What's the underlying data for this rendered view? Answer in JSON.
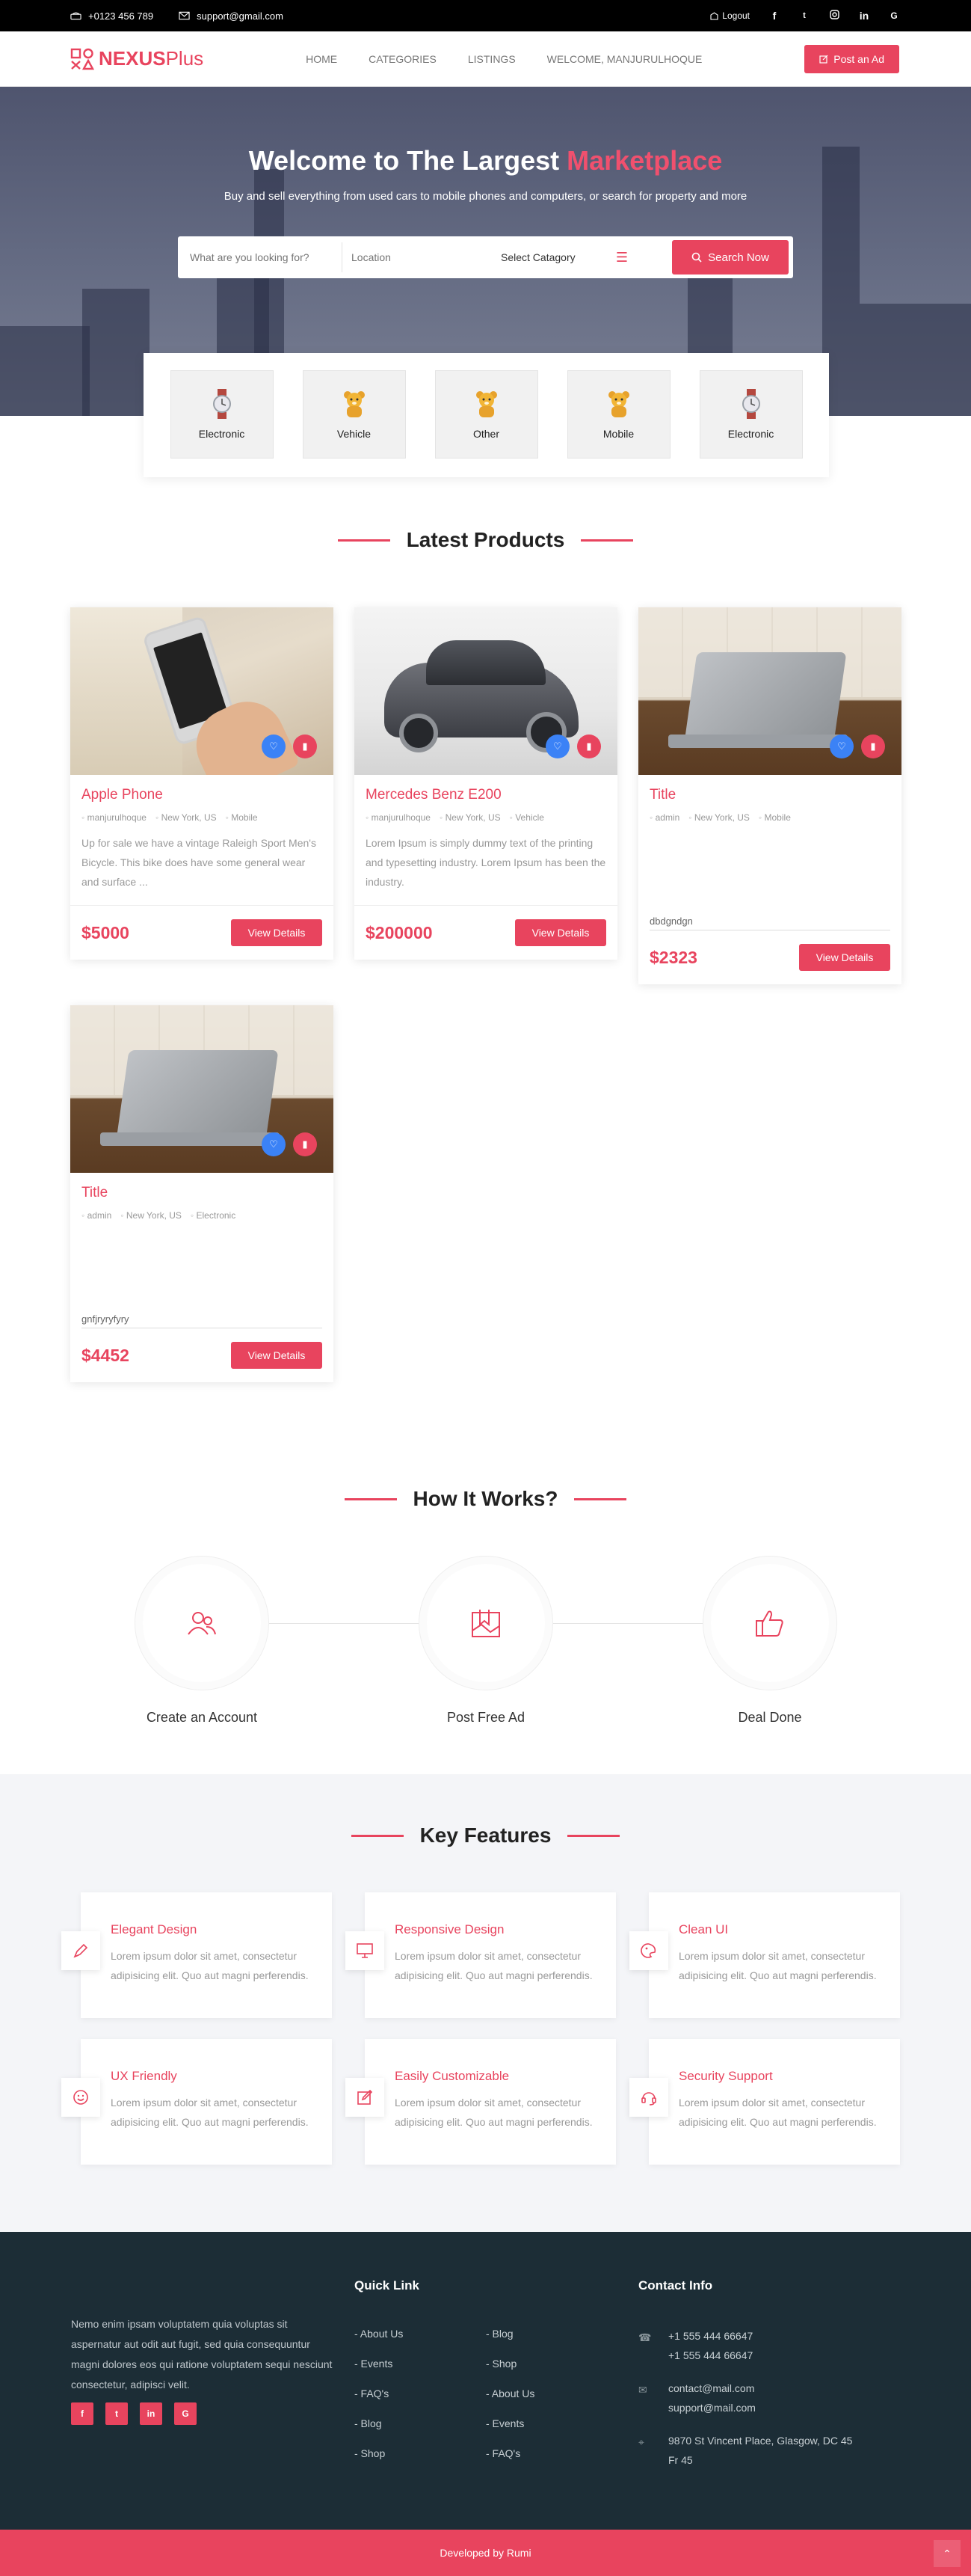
{
  "topbar": {
    "phone": "+0123 456 789",
    "email": "support@gmail.com",
    "logout": "Logout",
    "social": [
      "f",
      "t",
      "ig",
      "in",
      "G"
    ]
  },
  "nav": {
    "logo_main": "NEXUS",
    "logo_plus": "Plus",
    "links": [
      "HOME",
      "CATEGORIES",
      "LISTINGS",
      "WELCOME, MANJURULHOQUE"
    ],
    "post_ad": "Post an Ad"
  },
  "hero": {
    "title_main": "Welcome to The Largest",
    "title_accent": "Marketplace",
    "subtitle": "Buy and sell everything from used cars to mobile phones and computers, or search for property and more",
    "search_placeholder": "What are you looking for?",
    "location_placeholder": "Location",
    "category_select": "Select Catagory",
    "search_button": "Search Now"
  },
  "categories": [
    {
      "label": "Electronic",
      "icon": "watch-icon"
    },
    {
      "label": "Vehicle",
      "icon": "bear-icon"
    },
    {
      "label": "Other",
      "icon": "bear-icon"
    },
    {
      "label": "Mobile",
      "icon": "bear-icon"
    },
    {
      "label": "Electronic",
      "icon": "watch-icon"
    }
  ],
  "latest": {
    "heading": "Latest Products",
    "view_details": "View Details",
    "products": [
      {
        "title": "Apple Phone",
        "user": "manjurulhoque",
        "location": "New York, US",
        "category": "Mobile",
        "desc": "Up for sale we have a vintage Raleigh Sport Men's Bicycle. This bike does have some general wear and surface ...",
        "extra": "",
        "price": "$5000"
      },
      {
        "title": "Mercedes Benz E200",
        "user": "manjurulhoque",
        "location": "New York, US",
        "category": "Vehicle",
        "desc": "Lorem Ipsum is simply dummy text of the printing and typesetting industry. Lorem Ipsum has been the industry.",
        "extra": "",
        "price": "$200000"
      },
      {
        "title": "Title",
        "user": "admin",
        "location": "New York, US",
        "category": "Mobile",
        "desc": "",
        "extra": "dbdgndgn",
        "price": "$2323"
      },
      {
        "title": "Title",
        "user": "admin",
        "location": "New York, US",
        "category": "Electronic",
        "desc": "",
        "extra": "gnfjryryfyry",
        "price": "$4452"
      }
    ]
  },
  "how": {
    "heading": "How It Works?",
    "steps": [
      {
        "label": "Create an Account",
        "icon": "users-icon"
      },
      {
        "label": "Post Free Ad",
        "icon": "bookmark-map-icon"
      },
      {
        "label": "Deal Done",
        "icon": "thumbs-up-icon"
      }
    ]
  },
  "features": {
    "heading": "Key Features",
    "items": [
      {
        "title": "Elegant Design",
        "text": "Lorem ipsum dolor sit amet, consectetur adipisicing elit. Quo aut magni perferendis.",
        "icon": "pen-icon"
      },
      {
        "title": "Responsive Design",
        "text": "Lorem ipsum dolor sit amet, consectetur adipisicing elit. Quo aut magni perferendis.",
        "icon": "monitor-icon"
      },
      {
        "title": "Clean UI",
        "text": "Lorem ipsum dolor sit amet, consectetur adipisicing elit. Quo aut magni perferendis.",
        "icon": "palette-icon"
      },
      {
        "title": "UX Friendly",
        "text": "Lorem ipsum dolor sit amet, consectetur adipisicing elit. Quo aut magni perferendis.",
        "icon": "smile-icon"
      },
      {
        "title": "Easily Customizable",
        "text": "Lorem ipsum dolor sit amet, consectetur adipisicing elit. Quo aut magni perferendis.",
        "icon": "edit-icon"
      },
      {
        "title": "Security Support",
        "text": "Lorem ipsum dolor sit amet, consectetur adipisicing elit. Quo aut magni perferendis.",
        "icon": "headset-icon"
      }
    ]
  },
  "footer": {
    "about": "Nemo enim ipsam voluptatem quia voluptas sit aspernatur aut odit aut fugit, sed quia consequuntur magni dolores eos qui ratione voluptatem sequi nesciunt consectetur, adipisci velit.",
    "socials": [
      "f",
      "t",
      "in",
      "G"
    ],
    "quick_heading": "Quick Link",
    "quick_col1": [
      "- About Us",
      "- Events",
      "- FAQ's",
      "- Blog",
      "- Shop"
    ],
    "quick_col2": [
      "- Blog",
      "- Shop",
      "- About Us",
      "- Events",
      "- FAQ's"
    ],
    "contact_heading": "Contact Info",
    "phone1": "+1 555 444 66647",
    "phone2": "+1 555 444 66647",
    "email1": "contact@mail.com",
    "email2": "support@mail.com",
    "address1": "9870 St Vincent Place, Glasgow, DC 45",
    "address2": "Fr 45",
    "developed": "Developed by Rumi"
  },
  "colors": {
    "accent": "#e8445e",
    "footer_bg": "#1c2d36",
    "blue": "#3b82f6"
  }
}
